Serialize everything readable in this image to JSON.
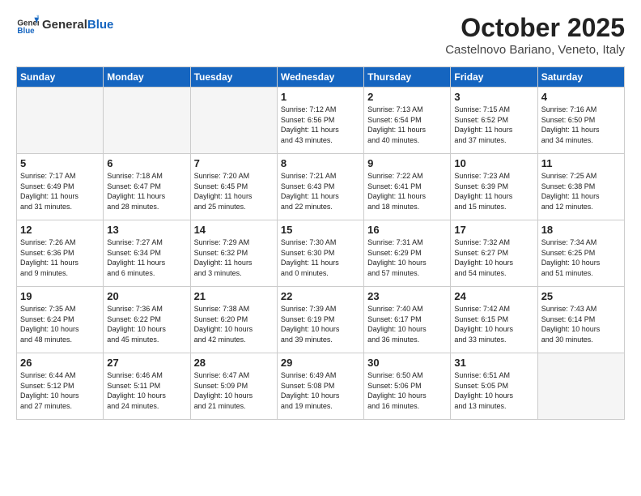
{
  "header": {
    "logo_general": "General",
    "logo_blue": "Blue",
    "month_title": "October 2025",
    "location": "Castelnovo Bariano, Veneto, Italy"
  },
  "days_of_week": [
    "Sunday",
    "Monday",
    "Tuesday",
    "Wednesday",
    "Thursday",
    "Friday",
    "Saturday"
  ],
  "weeks": [
    [
      {
        "day": "",
        "info": ""
      },
      {
        "day": "",
        "info": ""
      },
      {
        "day": "",
        "info": ""
      },
      {
        "day": "1",
        "info": "Sunrise: 7:12 AM\nSunset: 6:56 PM\nDaylight: 11 hours\nand 43 minutes."
      },
      {
        "day": "2",
        "info": "Sunrise: 7:13 AM\nSunset: 6:54 PM\nDaylight: 11 hours\nand 40 minutes."
      },
      {
        "day": "3",
        "info": "Sunrise: 7:15 AM\nSunset: 6:52 PM\nDaylight: 11 hours\nand 37 minutes."
      },
      {
        "day": "4",
        "info": "Sunrise: 7:16 AM\nSunset: 6:50 PM\nDaylight: 11 hours\nand 34 minutes."
      }
    ],
    [
      {
        "day": "5",
        "info": "Sunrise: 7:17 AM\nSunset: 6:49 PM\nDaylight: 11 hours\nand 31 minutes."
      },
      {
        "day": "6",
        "info": "Sunrise: 7:18 AM\nSunset: 6:47 PM\nDaylight: 11 hours\nand 28 minutes."
      },
      {
        "day": "7",
        "info": "Sunrise: 7:20 AM\nSunset: 6:45 PM\nDaylight: 11 hours\nand 25 minutes."
      },
      {
        "day": "8",
        "info": "Sunrise: 7:21 AM\nSunset: 6:43 PM\nDaylight: 11 hours\nand 22 minutes."
      },
      {
        "day": "9",
        "info": "Sunrise: 7:22 AM\nSunset: 6:41 PM\nDaylight: 11 hours\nand 18 minutes."
      },
      {
        "day": "10",
        "info": "Sunrise: 7:23 AM\nSunset: 6:39 PM\nDaylight: 11 hours\nand 15 minutes."
      },
      {
        "day": "11",
        "info": "Sunrise: 7:25 AM\nSunset: 6:38 PM\nDaylight: 11 hours\nand 12 minutes."
      }
    ],
    [
      {
        "day": "12",
        "info": "Sunrise: 7:26 AM\nSunset: 6:36 PM\nDaylight: 11 hours\nand 9 minutes."
      },
      {
        "day": "13",
        "info": "Sunrise: 7:27 AM\nSunset: 6:34 PM\nDaylight: 11 hours\nand 6 minutes."
      },
      {
        "day": "14",
        "info": "Sunrise: 7:29 AM\nSunset: 6:32 PM\nDaylight: 11 hours\nand 3 minutes."
      },
      {
        "day": "15",
        "info": "Sunrise: 7:30 AM\nSunset: 6:30 PM\nDaylight: 11 hours\nand 0 minutes."
      },
      {
        "day": "16",
        "info": "Sunrise: 7:31 AM\nSunset: 6:29 PM\nDaylight: 10 hours\nand 57 minutes."
      },
      {
        "day": "17",
        "info": "Sunrise: 7:32 AM\nSunset: 6:27 PM\nDaylight: 10 hours\nand 54 minutes."
      },
      {
        "day": "18",
        "info": "Sunrise: 7:34 AM\nSunset: 6:25 PM\nDaylight: 10 hours\nand 51 minutes."
      }
    ],
    [
      {
        "day": "19",
        "info": "Sunrise: 7:35 AM\nSunset: 6:24 PM\nDaylight: 10 hours\nand 48 minutes."
      },
      {
        "day": "20",
        "info": "Sunrise: 7:36 AM\nSunset: 6:22 PM\nDaylight: 10 hours\nand 45 minutes."
      },
      {
        "day": "21",
        "info": "Sunrise: 7:38 AM\nSunset: 6:20 PM\nDaylight: 10 hours\nand 42 minutes."
      },
      {
        "day": "22",
        "info": "Sunrise: 7:39 AM\nSunset: 6:19 PM\nDaylight: 10 hours\nand 39 minutes."
      },
      {
        "day": "23",
        "info": "Sunrise: 7:40 AM\nSunset: 6:17 PM\nDaylight: 10 hours\nand 36 minutes."
      },
      {
        "day": "24",
        "info": "Sunrise: 7:42 AM\nSunset: 6:15 PM\nDaylight: 10 hours\nand 33 minutes."
      },
      {
        "day": "25",
        "info": "Sunrise: 7:43 AM\nSunset: 6:14 PM\nDaylight: 10 hours\nand 30 minutes."
      }
    ],
    [
      {
        "day": "26",
        "info": "Sunrise: 6:44 AM\nSunset: 5:12 PM\nDaylight: 10 hours\nand 27 minutes."
      },
      {
        "day": "27",
        "info": "Sunrise: 6:46 AM\nSunset: 5:11 PM\nDaylight: 10 hours\nand 24 minutes."
      },
      {
        "day": "28",
        "info": "Sunrise: 6:47 AM\nSunset: 5:09 PM\nDaylight: 10 hours\nand 21 minutes."
      },
      {
        "day": "29",
        "info": "Sunrise: 6:49 AM\nSunset: 5:08 PM\nDaylight: 10 hours\nand 19 minutes."
      },
      {
        "day": "30",
        "info": "Sunrise: 6:50 AM\nSunset: 5:06 PM\nDaylight: 10 hours\nand 16 minutes."
      },
      {
        "day": "31",
        "info": "Sunrise: 6:51 AM\nSunset: 5:05 PM\nDaylight: 10 hours\nand 13 minutes."
      },
      {
        "day": "",
        "info": ""
      }
    ]
  ]
}
